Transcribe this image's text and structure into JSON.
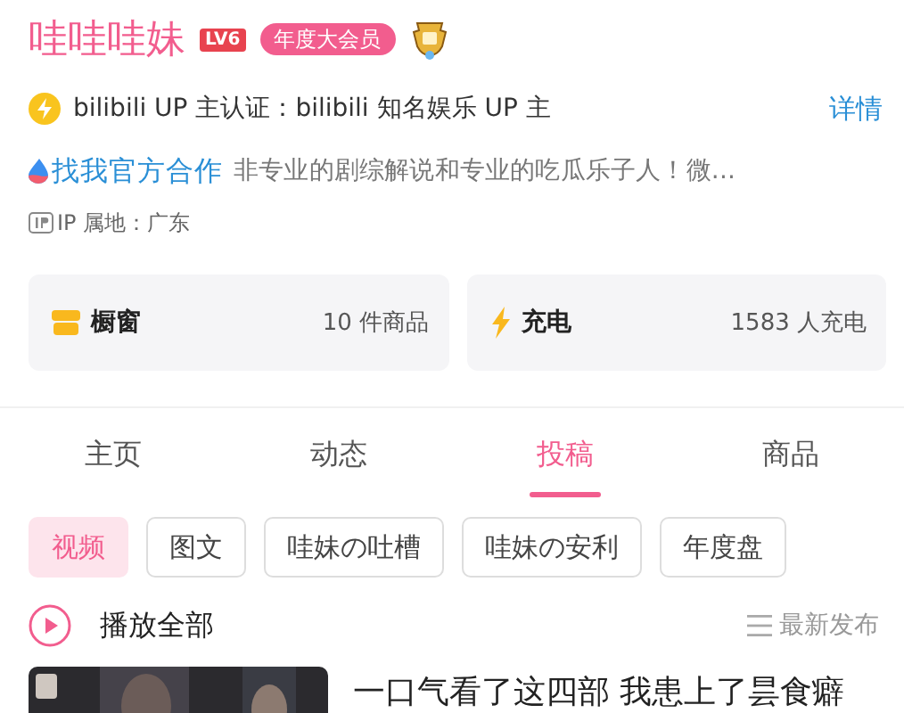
{
  "profile": {
    "name": "哇哇哇妹",
    "level": "LV6",
    "vip_badge": "年度大会员",
    "certification": "bilibili UP 主认证：bilibili 知名娱乐 UP 主",
    "details_link": "详情",
    "cooperation_link": "找我官方合作",
    "bio": "非专业的剧综解说和专业的吃瓜乐子人！微...",
    "ip_location": "IP 属地：广东"
  },
  "cards": [
    {
      "kind": "shop",
      "title": "橱窗",
      "value": "10 件商品"
    },
    {
      "kind": "charge",
      "title": "充电",
      "value": "1583 人充电"
    }
  ],
  "tabs": [
    {
      "label": "主页",
      "selected": false
    },
    {
      "label": "动态",
      "selected": false
    },
    {
      "label": "投稿",
      "selected": true
    },
    {
      "label": "商品",
      "selected": false
    }
  ],
  "filters": [
    {
      "label": "视频",
      "selected": true
    },
    {
      "label": "图文",
      "selected": false
    },
    {
      "label": "哇妹の吐槽",
      "selected": false
    },
    {
      "label": "哇妹の安利",
      "selected": false
    },
    {
      "label": "年度盘",
      "selected": false
    }
  ],
  "play_all": "播放全部",
  "sort": "最新发布",
  "videos": [
    {
      "title": "一口气看了这四部 我患上了昙食癖"
    }
  ]
}
